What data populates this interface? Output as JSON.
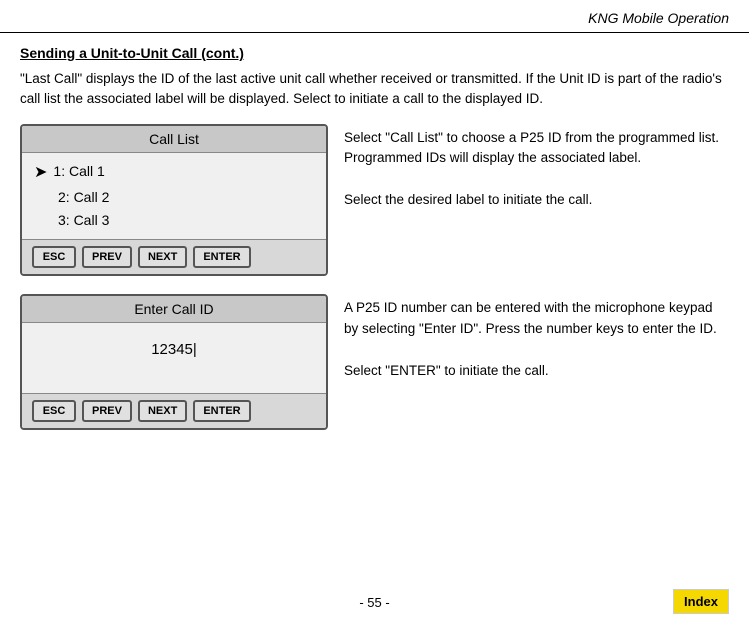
{
  "header": {
    "title": "KNG Mobile Operation"
  },
  "section": {
    "title": "Sending a Unit-to-Unit Call (cont.)",
    "intro": "\"Last Call\" displays the ID of the last active unit call whether received or transmitted. If the Unit ID is part of the radio's call list the associated label will be displayed. Select to initiate a call to the displayed ID."
  },
  "call_list_panel": {
    "title": "Call List",
    "rows": [
      {
        "arrow": true,
        "text": "1: Call 1"
      },
      {
        "arrow": false,
        "text": "2: Call 2"
      },
      {
        "arrow": false,
        "text": "3: Call 3"
      }
    ],
    "buttons": [
      "ESC",
      "PREV",
      "NEXT",
      "ENTER"
    ],
    "description1": "Select \"Call List\" to choose a P25 ID from the programmed list. Programmed IDs will display the associated label.",
    "description2": "Select the desired label to initiate the call."
  },
  "enter_id_panel": {
    "title": "Enter Call ID",
    "value": "12345|",
    "buttons": [
      "ESC",
      "PREV",
      "NEXT",
      "ENTER"
    ],
    "description1": "A P25 ID number can be entered with the microphone keypad by selecting \"Enter ID\". Press the number keys to enter the ID.",
    "description2": "Select \"ENTER\" to initiate the call."
  },
  "footer": {
    "page": "- 55 -",
    "index_label": "Index"
  }
}
